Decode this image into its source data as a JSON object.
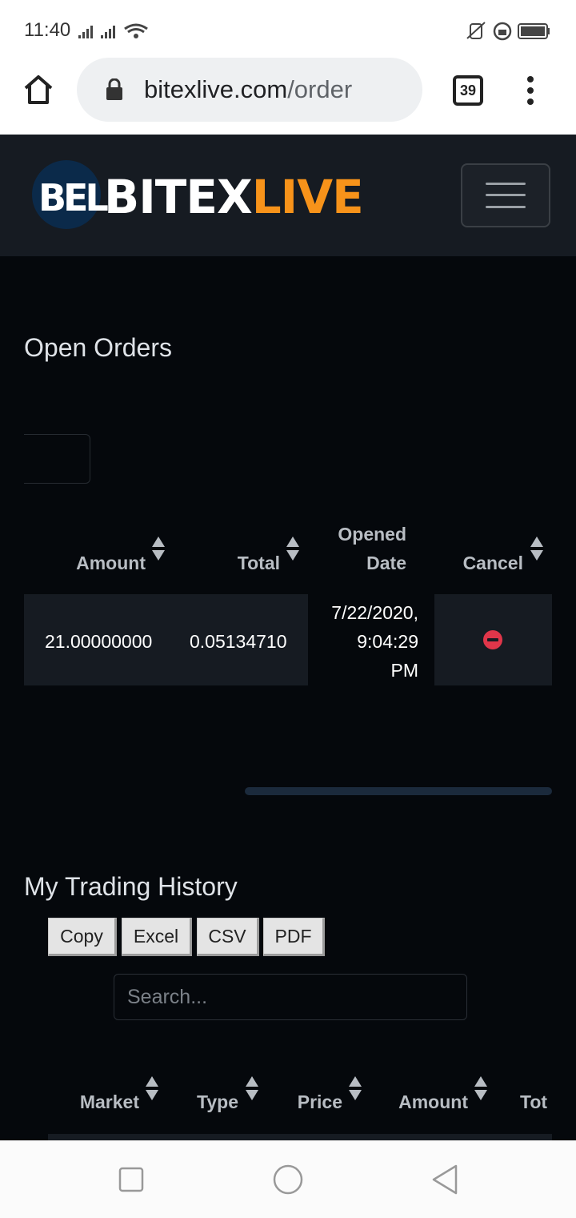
{
  "status_bar": {
    "time": "11:40"
  },
  "browser": {
    "url_domain": "bitexlive.com",
    "url_path": "/order",
    "tab_count": "39"
  },
  "site": {
    "logo_mark": "BEL",
    "logo_word_1": "BITEX",
    "logo_word_2": "LIVE",
    "accent_color": "#f7931a"
  },
  "open_orders": {
    "title": "Open Orders",
    "columns": {
      "amount": "Amount",
      "total": "Total",
      "opened_1": "Opened",
      "opened_2": "Date",
      "cancel": "Cancel"
    },
    "rows": [
      {
        "amount": "21.00000000",
        "total": "0.05134710",
        "date_1": "7/22/2020,",
        "date_2": "9:04:29",
        "date_3": "PM"
      }
    ]
  },
  "trading_history": {
    "title": "My Trading History",
    "buttons": {
      "copy": "Copy",
      "excel": "Excel",
      "csv": "CSV",
      "pdf": "PDF"
    },
    "search_placeholder": "Search...",
    "columns": {
      "market": "Market",
      "type": "Type",
      "price": "Price",
      "amount": "Amount",
      "total": "Tot"
    }
  },
  "icons": {
    "home": "home-icon",
    "lock": "lock-icon",
    "menu": "more-vert-icon",
    "cancel": "minus-circle-icon",
    "recent": "square-icon",
    "home_nav": "circle-icon",
    "back": "triangle-back-icon"
  }
}
